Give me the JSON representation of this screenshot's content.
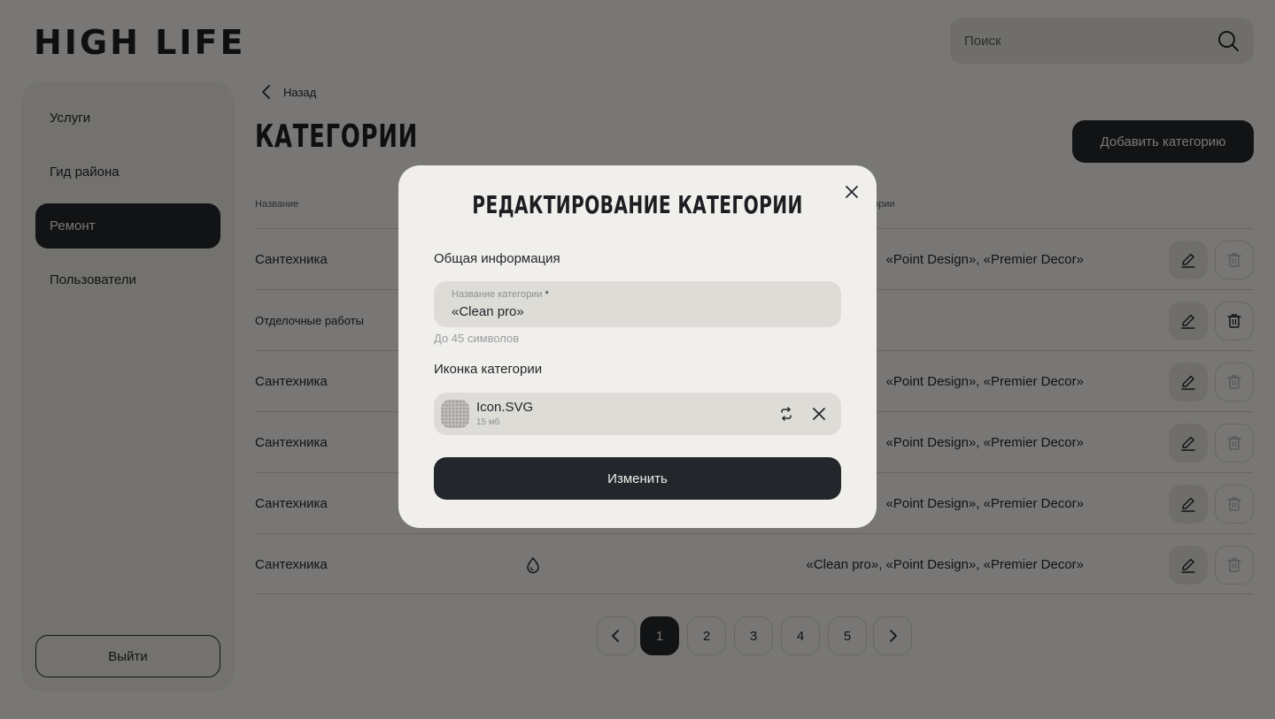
{
  "header": {
    "logo": "HIGH LIFE",
    "search": {
      "placeholder": "Поиск",
      "icon": "search-icon"
    }
  },
  "sidebar": {
    "items": [
      {
        "label": "Услуги",
        "active": false
      },
      {
        "label": "Гид района",
        "active": false
      },
      {
        "label": "Ремонт",
        "active": true
      },
      {
        "label": "Пользователи",
        "active": false
      }
    ],
    "logout_label": "Выйти"
  },
  "main": {
    "back_label": "Назад",
    "title": "КАТЕГОРИИ",
    "add_button": "Добавить категорию",
    "columns": [
      "Название",
      "ории"
    ],
    "rows": [
      {
        "name": "Сантехника",
        "companies": "«Point Design», «Premier Decor»",
        "delete_enabled": false
      },
      {
        "name": "Отделочные работы",
        "companies": "",
        "delete_enabled": true
      },
      {
        "name": "Сантехника",
        "companies": "«Point Design», «Premier Decor»",
        "delete_enabled": false
      },
      {
        "name": "Сантехника",
        "companies": "«Point Design», «Premier Decor»",
        "delete_enabled": false
      },
      {
        "name": "Сантехника",
        "companies": "«Point Design», «Premier Decor»",
        "delete_enabled": false
      },
      {
        "name": "Сантехника",
        "companies": "«Clean pro», «Point Design», «Premier Decor»",
        "delete_enabled": false,
        "icon": "water-drop-icon"
      }
    ]
  },
  "pagination": {
    "pages": [
      "1",
      "2",
      "3",
      "4",
      "5"
    ],
    "current": "1"
  },
  "modal": {
    "title": "РЕДАКТИРОВАНИЕ КАТЕГОРИИ",
    "general_section": "Общая информация",
    "name_field": {
      "label": "Название категории",
      "required_mark": "*",
      "value": "«Clean pro»"
    },
    "hint": "До 45 символов",
    "icon_section": "Иконка категории",
    "file": {
      "name": "Icon.SVG",
      "size": "15 мб"
    },
    "submit_label": "Изменить"
  },
  "colors": {
    "dark": "#23262b",
    "background": "#f0efeb",
    "surface": "#dedcd7",
    "overlay": "rgba(0,0,0,0.5)"
  }
}
